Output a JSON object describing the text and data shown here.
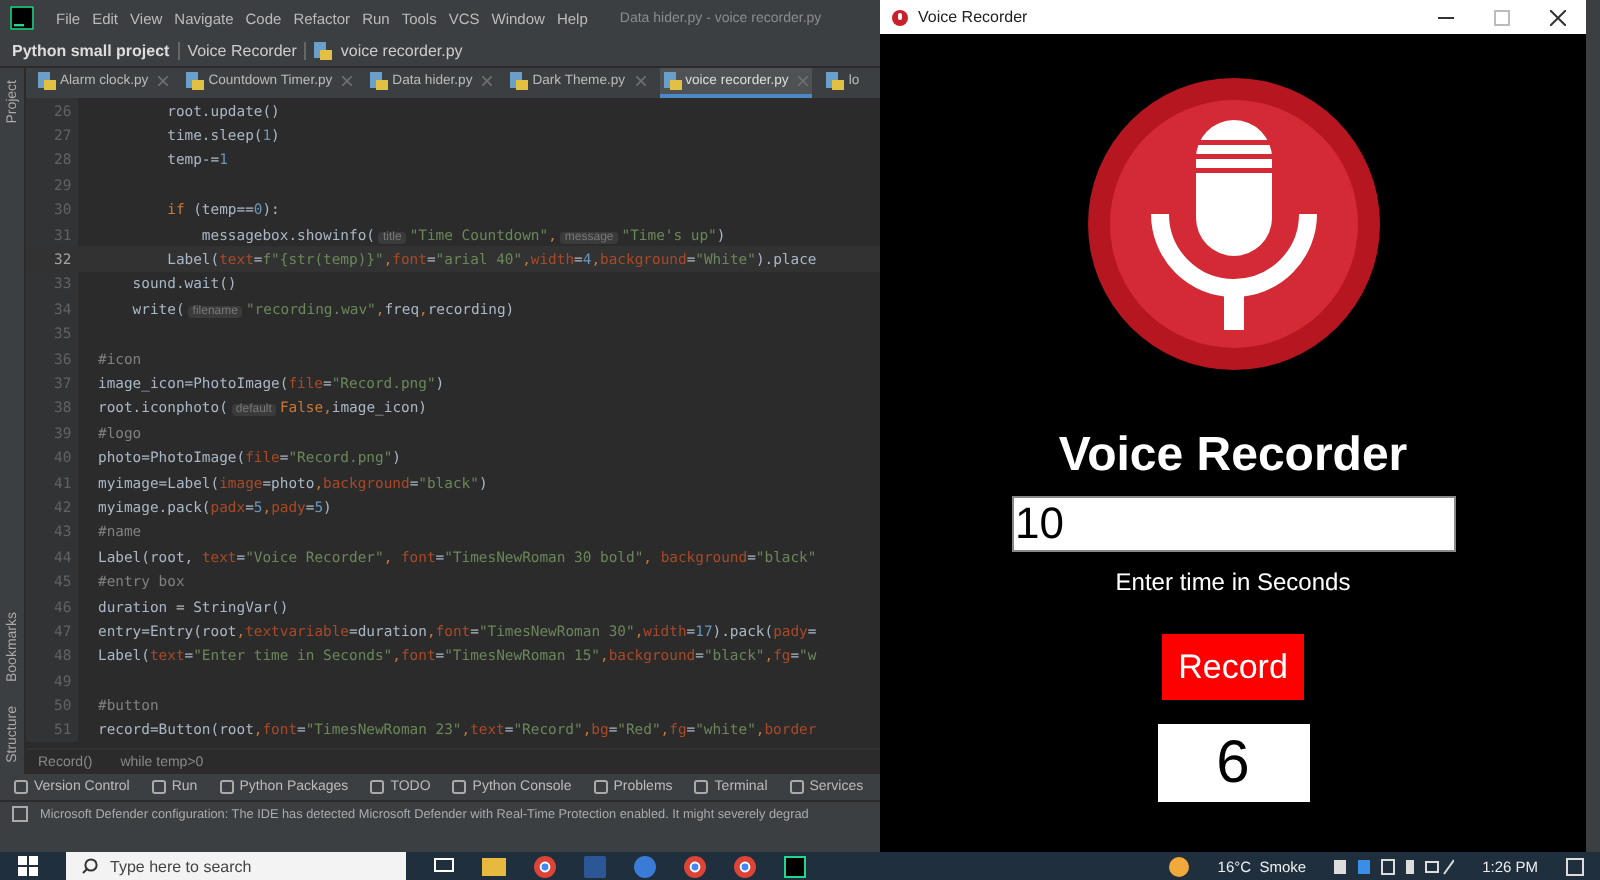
{
  "ide": {
    "menu": [
      "File",
      "Edit",
      "View",
      "Navigate",
      "Code",
      "Refactor",
      "Run",
      "Tools",
      "VCS",
      "Window",
      "Help"
    ],
    "window_title": "Data hider.py - voice recorder.py",
    "breadcrumb": [
      {
        "kind": "project",
        "label": "Python small project"
      },
      {
        "kind": "folder",
        "label": "Voice Recorder"
      },
      {
        "kind": "file",
        "label": "voice recorder.py"
      }
    ],
    "tool_strip": {
      "top": [
        "Project"
      ],
      "bottom": [
        "Bookmarks",
        "Structure"
      ]
    },
    "tabs": [
      {
        "label": "Alarm clock.py",
        "selected": false
      },
      {
        "label": "Countdown Timer.py",
        "selected": false
      },
      {
        "label": "Data hider.py",
        "selected": false
      },
      {
        "label": "Dark Theme.py",
        "selected": false
      },
      {
        "label": "voice recorder.py",
        "selected": true
      },
      {
        "label": "lo",
        "selected": false
      }
    ],
    "code_lines": [
      {
        "number": "26",
        "current": false,
        "segments": [
          {
            "kind": "plain",
            "text": "        root.update()"
          }
        ]
      },
      {
        "number": "27",
        "current": false,
        "segments": [
          {
            "kind": "plain",
            "text": "        time.sleep("
          },
          {
            "kind": "num",
            "text": "1"
          },
          {
            "kind": "plain",
            "text": ")"
          }
        ]
      },
      {
        "number": "28",
        "current": false,
        "segments": [
          {
            "kind": "plain",
            "text": "        temp-="
          },
          {
            "kind": "num",
            "text": "1"
          }
        ]
      },
      {
        "number": "29",
        "current": false
      },
      {
        "number": "30",
        "current": false,
        "segments": [
          {
            "kind": "kw",
            "text": "        if"
          },
          {
            "kind": "plain",
            "text": " (temp=="
          },
          {
            "kind": "num",
            "text": "0"
          },
          {
            "kind": "plain",
            "text": "):"
          }
        ]
      },
      {
        "number": "31",
        "current": false,
        "segments": [
          {
            "kind": "plain",
            "text": "            messagebox.showinfo("
          },
          {
            "kind": "hint",
            "text": "title"
          },
          {
            "kind": "str",
            "text": "\"Time Countdown\""
          },
          {
            "kind": "kw",
            "text": ","
          },
          {
            "kind": "hint",
            "text": "message"
          },
          {
            "kind": "str",
            "text": "\"Time's up\""
          },
          {
            "kind": "plain",
            "text": ")"
          }
        ]
      },
      {
        "number": "32",
        "current": true,
        "segments": [
          {
            "kind": "plain",
            "text": "        Label("
          },
          {
            "kind": "param",
            "text": "text"
          },
          {
            "kind": "plain",
            "text": "="
          },
          {
            "kind": "str",
            "text": "f\"{str(temp)}\""
          },
          {
            "kind": "kw",
            "text": ","
          },
          {
            "kind": "param",
            "text": "font"
          },
          {
            "kind": "plain",
            "text": "="
          },
          {
            "kind": "str",
            "text": "\"arial 40\""
          },
          {
            "kind": "kw",
            "text": ","
          },
          {
            "kind": "param",
            "text": "width"
          },
          {
            "kind": "plain",
            "text": "="
          },
          {
            "kind": "num",
            "text": "4"
          },
          {
            "kind": "kw",
            "text": ","
          },
          {
            "kind": "param",
            "text": "background"
          },
          {
            "kind": "plain",
            "text": "="
          },
          {
            "kind": "str",
            "text": "\"White\""
          },
          {
            "kind": "plain",
            "text": ").place"
          }
        ]
      },
      {
        "number": "33",
        "current": false,
        "segments": [
          {
            "kind": "plain",
            "text": "    sound.wait()"
          }
        ]
      },
      {
        "number": "34",
        "current": false,
        "segments": [
          {
            "kind": "plain",
            "text": "    write("
          },
          {
            "kind": "hint",
            "text": "filename"
          },
          {
            "kind": "str",
            "text": "\"recording.wav\""
          },
          {
            "kind": "kw",
            "text": ","
          },
          {
            "kind": "plain",
            "text": "freq"
          },
          {
            "kind": "kw",
            "text": ","
          },
          {
            "kind": "plain",
            "text": "recording)"
          }
        ]
      },
      {
        "number": "35",
        "current": false
      },
      {
        "number": "36",
        "current": false,
        "segments": [
          {
            "kind": "cmt",
            "text": "#icon"
          }
        ]
      },
      {
        "number": "37",
        "current": false,
        "segments": [
          {
            "kind": "plain",
            "text": "image_icon=PhotoImage("
          },
          {
            "kind": "param",
            "text": "file"
          },
          {
            "kind": "plain",
            "text": "="
          },
          {
            "kind": "str",
            "text": "\"Record.png\""
          },
          {
            "kind": "plain",
            "text": ")"
          }
        ]
      },
      {
        "number": "38",
        "current": false,
        "segments": [
          {
            "kind": "plain",
            "text": "root.iconphoto("
          },
          {
            "kind": "hint",
            "text": "default"
          },
          {
            "kind": "kw",
            "text": "False"
          },
          {
            "kind": "kw",
            "text": ","
          },
          {
            "kind": "plain",
            "text": "image_icon)"
          }
        ]
      },
      {
        "number": "39",
        "current": false,
        "segments": [
          {
            "kind": "cmt",
            "text": "#logo"
          }
        ]
      },
      {
        "number": "40",
        "current": false,
        "segments": [
          {
            "kind": "plain",
            "text": "photo=PhotoImage("
          },
          {
            "kind": "param",
            "text": "file"
          },
          {
            "kind": "plain",
            "text": "="
          },
          {
            "kind": "str",
            "text": "\"Record.png\""
          },
          {
            "kind": "plain",
            "text": ")"
          }
        ]
      },
      {
        "number": "41",
        "current": false,
        "segments": [
          {
            "kind": "plain",
            "text": "myimage=Label("
          },
          {
            "kind": "param",
            "text": "image"
          },
          {
            "kind": "plain",
            "text": "=photo"
          },
          {
            "kind": "kw",
            "text": ","
          },
          {
            "kind": "param",
            "text": "background"
          },
          {
            "kind": "plain",
            "text": "="
          },
          {
            "kind": "str",
            "text": "\"black\""
          },
          {
            "kind": "plain",
            "text": ")"
          }
        ]
      },
      {
        "number": "42",
        "current": false,
        "segments": [
          {
            "kind": "plain",
            "text": "myimage.pack("
          },
          {
            "kind": "param",
            "text": "padx"
          },
          {
            "kind": "plain",
            "text": "="
          },
          {
            "kind": "num",
            "text": "5"
          },
          {
            "kind": "kw",
            "text": ","
          },
          {
            "kind": "param",
            "text": "pady"
          },
          {
            "kind": "plain",
            "text": "="
          },
          {
            "kind": "num",
            "text": "5"
          },
          {
            "kind": "plain",
            "text": ")"
          }
        ]
      },
      {
        "number": "43",
        "current": false,
        "segments": [
          {
            "kind": "cmt",
            "text": "#name"
          }
        ]
      },
      {
        "number": "44",
        "current": false,
        "segments": [
          {
            "kind": "plain",
            "text": "Label(root, "
          },
          {
            "kind": "param",
            "text": "text"
          },
          {
            "kind": "plain",
            "text": "="
          },
          {
            "kind": "str",
            "text": "\"Voice Recorder\""
          },
          {
            "kind": "kw",
            "text": ", "
          },
          {
            "kind": "param",
            "text": "font"
          },
          {
            "kind": "plain",
            "text": "="
          },
          {
            "kind": "str",
            "text": "\"TimesNewRoman 30 bold\""
          },
          {
            "kind": "kw",
            "text": ", "
          },
          {
            "kind": "param",
            "text": "background"
          },
          {
            "kind": "plain",
            "text": "="
          },
          {
            "kind": "str",
            "text": "\"black\""
          }
        ]
      },
      {
        "number": "45",
        "current": false,
        "segments": [
          {
            "kind": "cmt",
            "text": "#entry box"
          }
        ]
      },
      {
        "number": "46",
        "current": false,
        "segments": [
          {
            "kind": "plain",
            "text": "duration = StringVar()"
          }
        ]
      },
      {
        "number": "47",
        "current": false,
        "segments": [
          {
            "kind": "plain",
            "text": "entry=Entry(root"
          },
          {
            "kind": "kw",
            "text": ","
          },
          {
            "kind": "param",
            "text": "textvariable"
          },
          {
            "kind": "plain",
            "text": "=duration"
          },
          {
            "kind": "kw",
            "text": ","
          },
          {
            "kind": "param",
            "text": "font"
          },
          {
            "kind": "plain",
            "text": "="
          },
          {
            "kind": "str",
            "text": "\"TimesNewRoman 30\""
          },
          {
            "kind": "kw",
            "text": ","
          },
          {
            "kind": "param",
            "text": "width"
          },
          {
            "kind": "plain",
            "text": "="
          },
          {
            "kind": "num",
            "text": "17"
          },
          {
            "kind": "plain",
            "text": ").pack("
          },
          {
            "kind": "param",
            "text": "pady"
          },
          {
            "kind": "plain",
            "text": "="
          }
        ]
      },
      {
        "number": "48",
        "current": false,
        "segments": [
          {
            "kind": "plain",
            "text": "Label("
          },
          {
            "kind": "param",
            "text": "text"
          },
          {
            "kind": "plain",
            "text": "="
          },
          {
            "kind": "str",
            "text": "\"Enter time in Seconds\""
          },
          {
            "kind": "kw",
            "text": ","
          },
          {
            "kind": "param",
            "text": "font"
          },
          {
            "kind": "plain",
            "text": "="
          },
          {
            "kind": "str",
            "text": "\"TimesNewRoman 15\""
          },
          {
            "kind": "kw",
            "text": ","
          },
          {
            "kind": "param",
            "text": "background"
          },
          {
            "kind": "plain",
            "text": "="
          },
          {
            "kind": "str",
            "text": "\"black\""
          },
          {
            "kind": "kw",
            "text": ","
          },
          {
            "kind": "param",
            "text": "fg"
          },
          {
            "kind": "plain",
            "text": "="
          },
          {
            "kind": "str",
            "text": "\"w"
          }
        ]
      },
      {
        "number": "49",
        "current": false
      },
      {
        "number": "50",
        "current": false,
        "segments": [
          {
            "kind": "cmt",
            "text": "#button"
          }
        ]
      },
      {
        "number": "51",
        "current": false,
        "segments": [
          {
            "kind": "plain",
            "text": "record=Button(root"
          },
          {
            "kind": "kw",
            "text": ","
          },
          {
            "kind": "param",
            "text": "font"
          },
          {
            "kind": "plain",
            "text": "="
          },
          {
            "kind": "str",
            "text": "\"TimesNewRoman 23\""
          },
          {
            "kind": "kw",
            "text": ","
          },
          {
            "kind": "param",
            "text": "text"
          },
          {
            "kind": "plain",
            "text": "="
          },
          {
            "kind": "str",
            "text": "\"Record\""
          },
          {
            "kind": "kw",
            "text": ","
          },
          {
            "kind": "param",
            "text": "bg"
          },
          {
            "kind": "plain",
            "text": "="
          },
          {
            "kind": "str",
            "text": "\"Red\""
          },
          {
            "kind": "kw",
            "text": ","
          },
          {
            "kind": "param",
            "text": "fg"
          },
          {
            "kind": "plain",
            "text": "="
          },
          {
            "kind": "str",
            "text": "\"white\""
          },
          {
            "kind": "kw",
            "text": ","
          },
          {
            "kind": "param",
            "text": "border"
          }
        ]
      }
    ],
    "editor_breadcrumb": [
      "Record()",
      "while temp>0"
    ],
    "tool_windows": [
      "Version Control",
      "Run",
      "Python Packages",
      "TODO",
      "Python Console",
      "Problems",
      "Terminal",
      "Services"
    ],
    "notification": "Microsoft Defender configuration: The IDE has detected Microsoft Defender with Real-Time Protection enabled. It might severely degrad"
  },
  "app_window": {
    "title": "Voice Recorder",
    "heading": "Voice Recorder",
    "entry_value": "10",
    "hint": "Enter time in Seconds",
    "button": "Record",
    "countdown": "6"
  },
  "taskbar": {
    "search_placeholder": "Type here to search",
    "weather": "16°C  Smoke",
    "time": "1:26 PM"
  }
}
